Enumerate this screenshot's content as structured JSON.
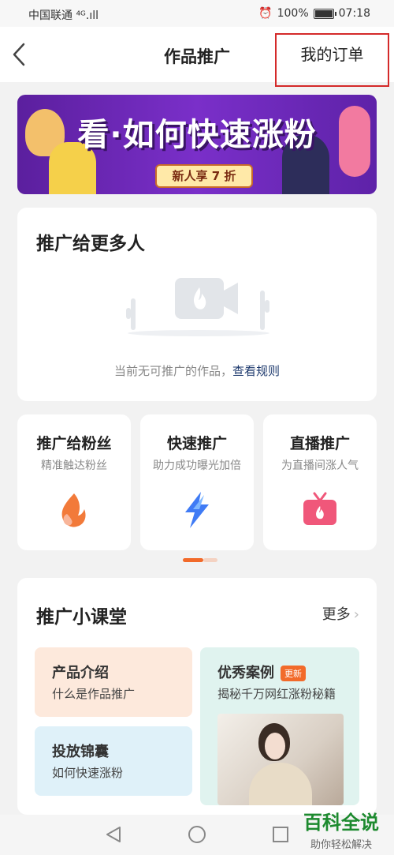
{
  "status_bar": {
    "carrier": "中国联通 ⁴ᴳ.ıll",
    "battery": "100%",
    "time": "07:18"
  },
  "nav": {
    "title": "作品推广",
    "orders": "我的订单"
  },
  "banner": {
    "title": "看·如何快速涨粉",
    "tag": "新人享 7 折"
  },
  "empty_state": {
    "title": "推广给更多人",
    "text": "当前无可推广的作品，",
    "link": "查看规则"
  },
  "features": [
    {
      "title": "推广给粉丝",
      "subtitle": "精准触达粉丝",
      "icon": "flame-icon"
    },
    {
      "title": "快速推广",
      "subtitle": "助力成功曝光加倍",
      "icon": "lightning-icon"
    },
    {
      "title": "直播推广",
      "subtitle": "为直播间涨人气",
      "icon": "live-tv-icon"
    }
  ],
  "classroom": {
    "title": "推广小课堂",
    "more": "更多",
    "tiles": {
      "product": {
        "title": "产品介绍",
        "subtitle": "什么是作品推广"
      },
      "bag": {
        "title": "投放锦囊",
        "subtitle": "如何快速涨粉"
      },
      "case": {
        "title": "优秀案例",
        "badge": "更新",
        "subtitle": "揭秘千万网红涨粉秘籍"
      }
    }
  },
  "watermark": {
    "title": "百科全说",
    "subtitle": "助你轻松解决"
  },
  "colors": {
    "accent": "#f26a2a",
    "highlight_box": "#d42a2a",
    "link": "#1e3a6e",
    "banner": "#7a2fc9"
  }
}
